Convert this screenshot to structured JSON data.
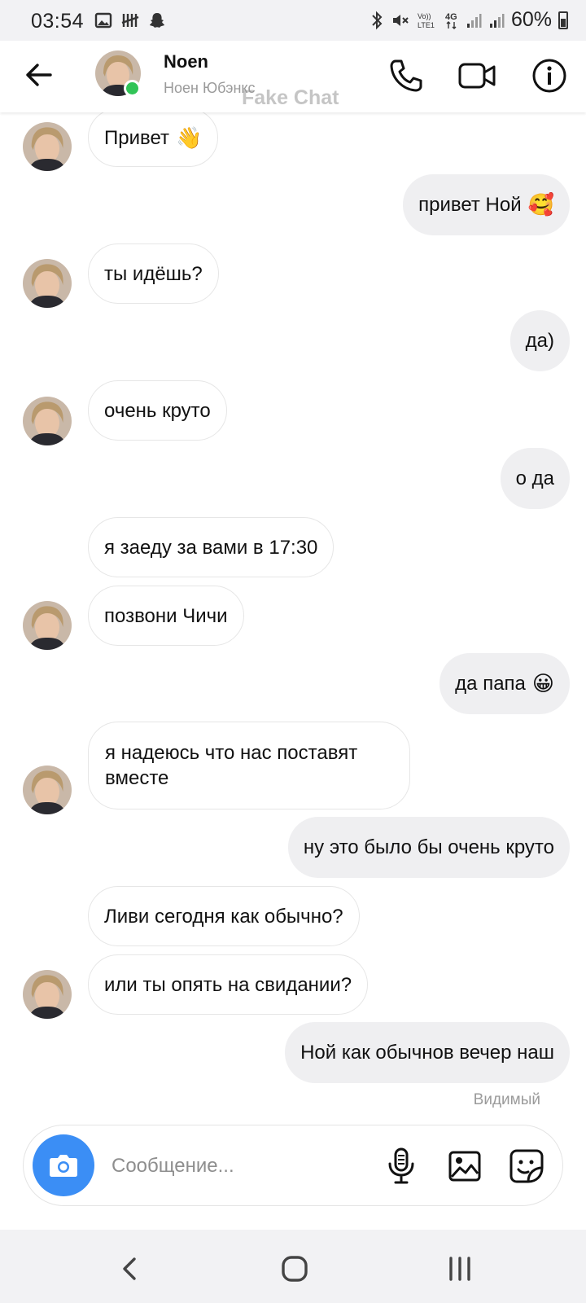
{
  "status_bar": {
    "time": "03:54",
    "left_icons": [
      "gallery-icon",
      "tally-icon",
      "snapchat-icon"
    ],
    "right_icons": [
      "bluetooth-icon",
      "mute-icon",
      "volte-icon",
      "4g-icon",
      "signal-icon",
      "signal-icon"
    ],
    "battery": "60%"
  },
  "header": {
    "name": "Noen",
    "subtitle": "Ноен Юбэнкс",
    "watermark": "Fake Chat",
    "online": true
  },
  "messages": [
    {
      "side": "in",
      "text": "Привет",
      "emoji": "👋",
      "avatar": true
    },
    {
      "side": "out",
      "text": "привет Ной",
      "emoji": "🥰"
    },
    {
      "side": "in",
      "text": "ты идёшь?",
      "avatar": true
    },
    {
      "side": "out",
      "text": "да)"
    },
    {
      "side": "in",
      "text": "очень круто",
      "avatar": true
    },
    {
      "side": "out",
      "text": "о да"
    },
    {
      "side": "in",
      "text": "я заеду за вами в 17:30",
      "avatar": false
    },
    {
      "side": "in",
      "text": "позвони Чичи",
      "avatar": true
    },
    {
      "side": "out",
      "text": "да папа",
      "emoji": "😀"
    },
    {
      "side": "in",
      "text": "я надеюсь что нас поставят вместе",
      "avatar": true
    },
    {
      "side": "out",
      "text": "ну это было бы очень круто"
    },
    {
      "side": "in",
      "text": "Ливи сегодня как обычно?",
      "avatar": false
    },
    {
      "side": "in",
      "text": "или ты опять на свидании?",
      "avatar": true
    },
    {
      "side": "out",
      "text": "Ной как обычнов вечер наш"
    }
  ],
  "seen_label": "Видимый",
  "composer": {
    "placeholder": "Сообщение...",
    "value": ""
  },
  "colors": {
    "accent": "#3b8ef5",
    "online": "#31c457",
    "outgoing_bubble": "#efeff1"
  }
}
